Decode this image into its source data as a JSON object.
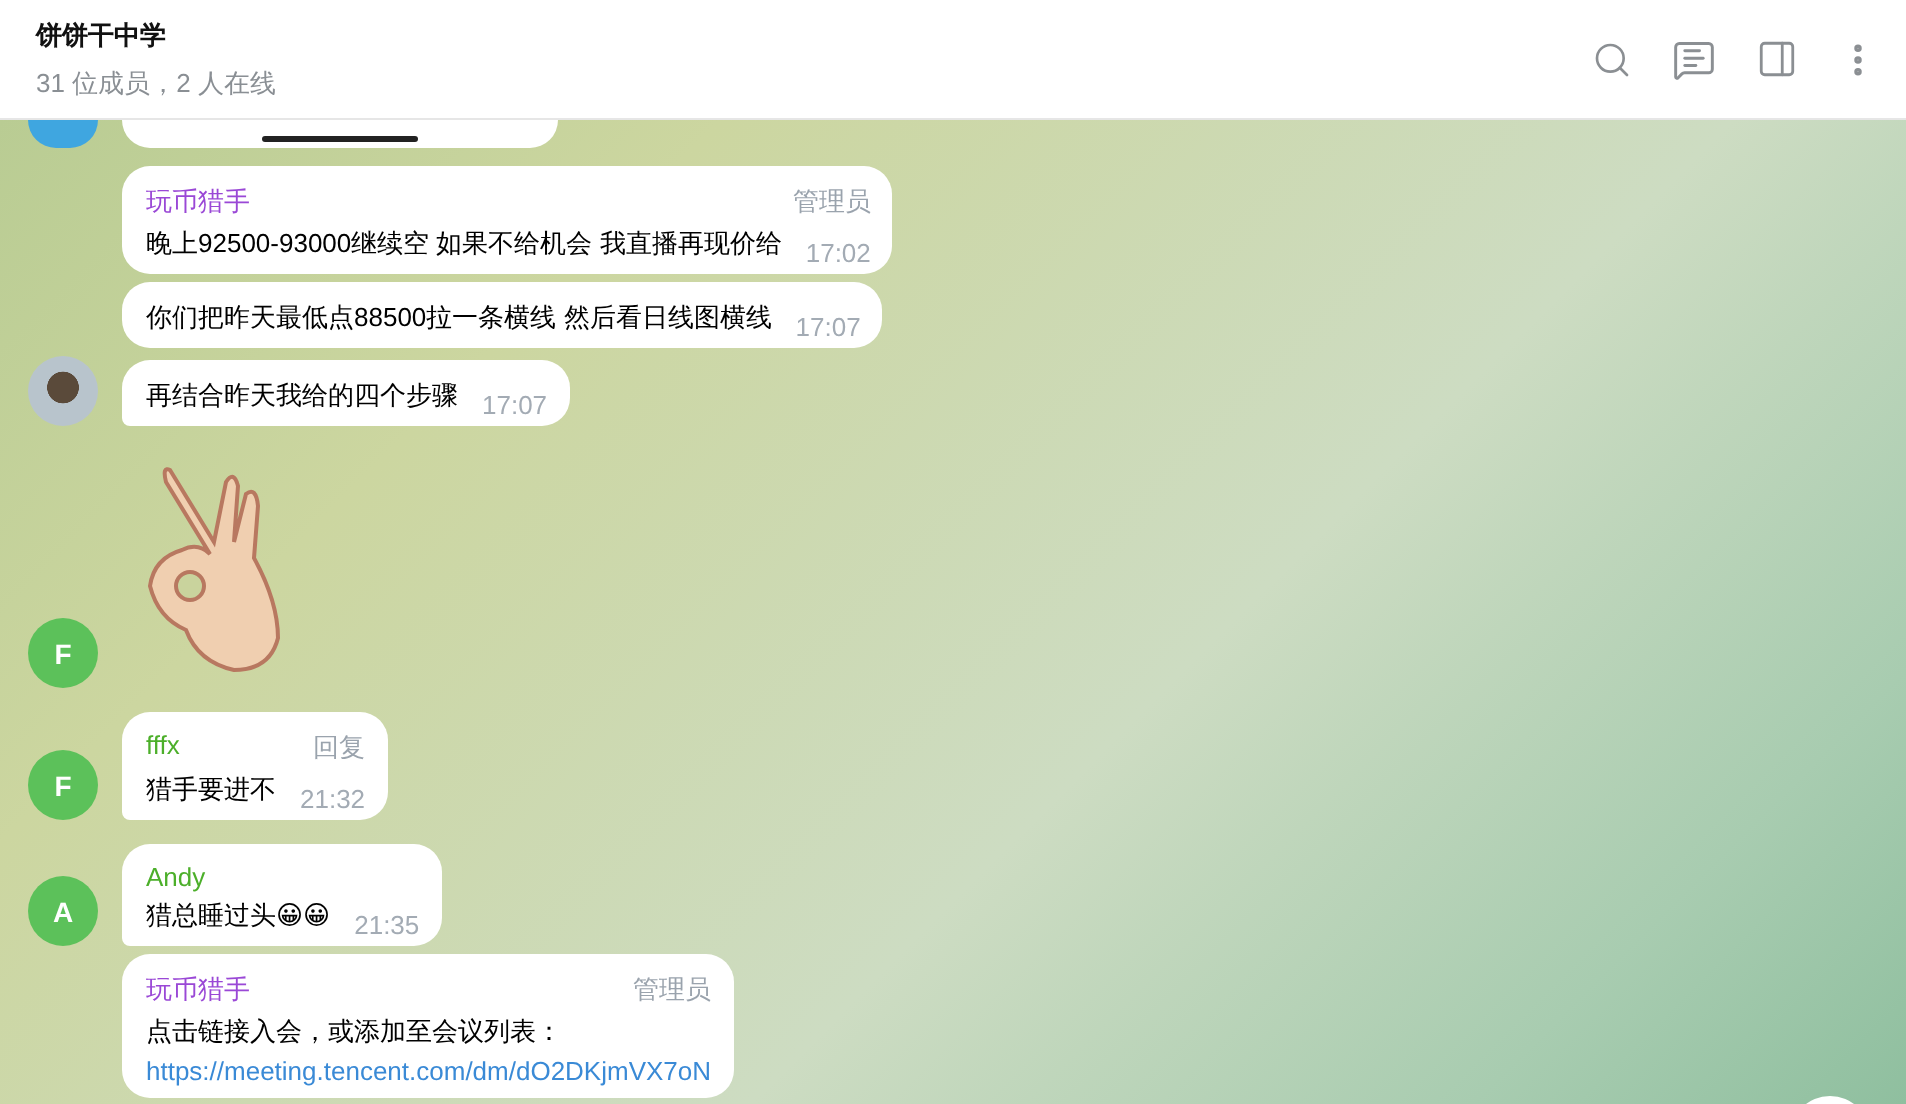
{
  "header": {
    "title": "饼饼干中学",
    "subtitle": "31 位成员，2 人在线"
  },
  "messages": [
    {
      "kind": "media",
      "avatar": {
        "kind": "cut",
        "color": "#3fa6e0"
      }
    },
    {
      "kind": "text",
      "sender": "玩币猎手",
      "color": "#9a48d6",
      "badge": "管理员",
      "text": "晚上92500-93000继续空 如果不给机会 我直播再现价给",
      "time": "17:02"
    },
    {
      "kind": "text",
      "text": "你们把昨天最低点88500拉一条横线  然后看日线图横线",
      "time": "17:07"
    },
    {
      "kind": "text",
      "text": "再结合昨天我给的四个步骤",
      "time": "17:07",
      "avatar": {
        "kind": "photo"
      }
    },
    {
      "kind": "sticker",
      "avatar": {
        "kind": "letter",
        "letter": "F",
        "color": "#5cc15a"
      }
    },
    {
      "kind": "text",
      "sender": "fffx",
      "color": "#4caf2a",
      "badge": "回复",
      "text": "猎手要进不",
      "time": "21:32",
      "avatar": {
        "kind": "letter",
        "letter": "F",
        "color": "#5cc15a"
      }
    },
    {
      "kind": "text",
      "sender": "Andy",
      "color": "#4caf2a",
      "text": "猎总睡过头😀😀",
      "time": "21:35",
      "avatar": {
        "kind": "letter",
        "letter": "A",
        "color": "#5cc15a"
      }
    },
    {
      "kind": "text",
      "sender": "玩币猎手",
      "color": "#9a48d6",
      "badge": "管理员",
      "text": "点击链接入会，或添加至会议列表：",
      "link": "https://meeting.tencent.com/dm/dO2DKjmVX7oN"
    }
  ]
}
